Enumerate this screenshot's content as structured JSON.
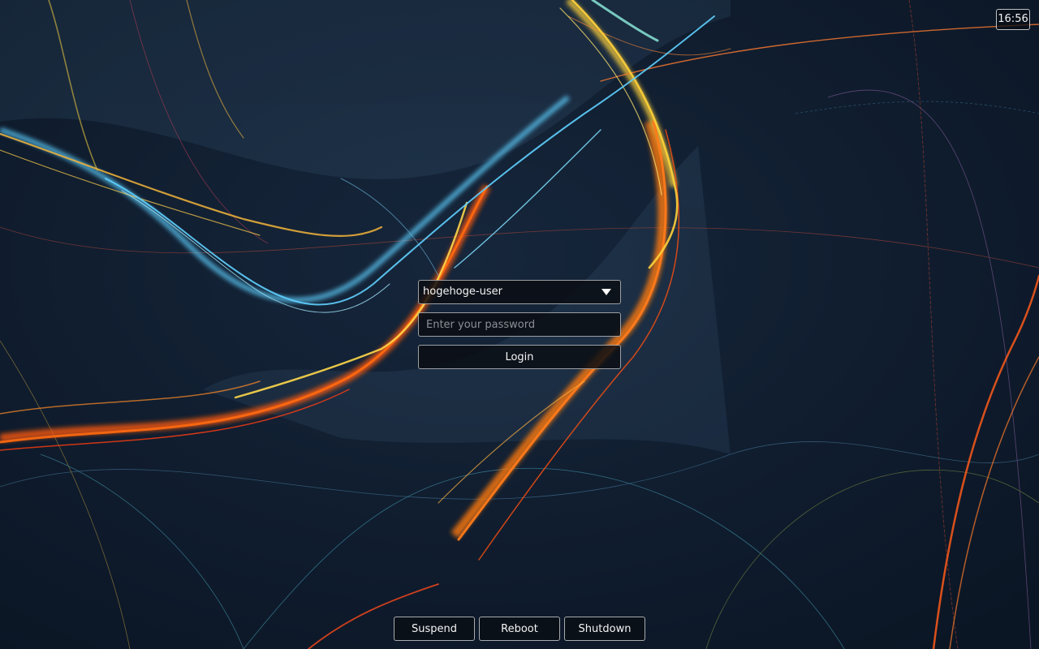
{
  "clock": {
    "time": "16:56"
  },
  "login": {
    "selected_user": "hogehoge-user",
    "password_placeholder": "Enter your password",
    "password_value": "",
    "login_label": "Login"
  },
  "power": {
    "suspend_label": "Suspend",
    "reboot_label": "Reboot",
    "shutdown_label": "Shutdown"
  },
  "icons": {
    "user_dropdown": "triangle-down-icon"
  },
  "colors": {
    "background": "#0d1a2b",
    "accent_orange": "#ff6a10",
    "accent_yellow": "#ffd23a",
    "accent_cyan": "#5fd0ff"
  }
}
